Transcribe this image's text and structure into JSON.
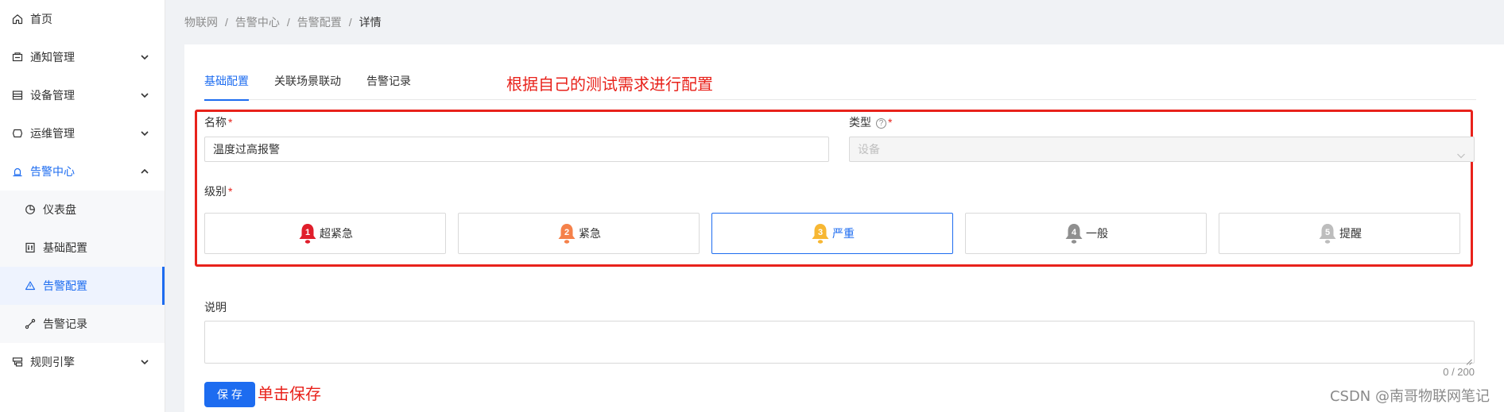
{
  "sidebar": {
    "items": [
      {
        "label": "首页",
        "icon": "home-icon"
      },
      {
        "label": "通知管理",
        "icon": "notice-icon"
      },
      {
        "label": "设备管理",
        "icon": "device-icon"
      },
      {
        "label": "运维管理",
        "icon": "ops-icon"
      },
      {
        "label": "告警中心",
        "icon": "alarm-icon"
      },
      {
        "label": "规则引擎",
        "icon": "rule-icon"
      }
    ],
    "alarm_sub": [
      {
        "label": "仪表盘",
        "icon": "pie-chart-icon"
      },
      {
        "label": "基础配置",
        "icon": "config-icon"
      },
      {
        "label": "告警配置",
        "icon": "warning-icon"
      },
      {
        "label": "告警记录",
        "icon": "record-icon"
      }
    ]
  },
  "breadcrumb": [
    "物联网",
    "告警中心",
    "告警配置",
    "详情"
  ],
  "breadcrumb_sep": "/",
  "tabs": [
    "基础配置",
    "关联场景联动",
    "告警记录"
  ],
  "annotations": {
    "top": "根据自己的测试需求进行配置",
    "save": "单击保存"
  },
  "form": {
    "name_label": "名称",
    "name_value": "温度过高报警",
    "type_label": "类型",
    "type_help": "?",
    "type_value": "设备",
    "level_label": "级别",
    "required_mark": "*",
    "levels": [
      {
        "num": "1",
        "label": "超紧急",
        "color": "#e01e2b"
      },
      {
        "num": "2",
        "label": "紧急",
        "color": "#f5814a"
      },
      {
        "num": "3",
        "label": "严重",
        "color": "#f7b733"
      },
      {
        "num": "4",
        "label": "一般",
        "color": "#8f8f8f"
      },
      {
        "num": "5",
        "label": "提醒",
        "color": "#bdbdbd"
      }
    ],
    "selected_level": "3",
    "desc_label": "说明",
    "desc_counter": "0 / 200",
    "save_label": "保 存"
  },
  "watermark": "CSDN @南哥物联网笔记",
  "colors": {
    "primary": "#1d6cf0",
    "annotation": "#e8221b"
  }
}
